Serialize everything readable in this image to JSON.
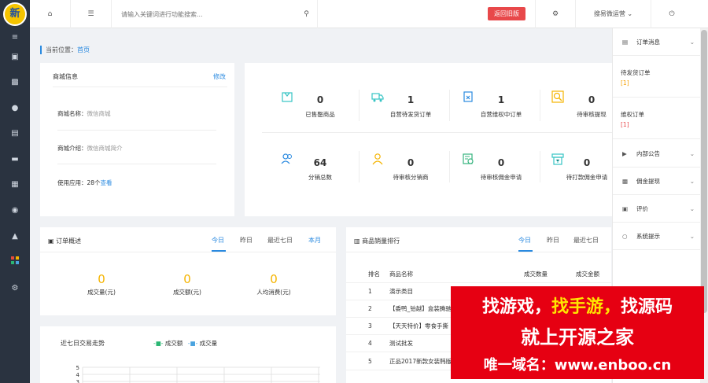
{
  "logo": {
    "text": "新"
  },
  "topbar": {
    "search_placeholder": "请输入关键词进行功能搜索...",
    "back_button": "返回旧版",
    "user_name": "搜易微运营"
  },
  "breadcrumb": {
    "label": "当前位置：",
    "current": "首页"
  },
  "shop_info": {
    "title": "商城信息",
    "edit_label": "修改",
    "name_label": "商城名称：",
    "name_value": "微信商城",
    "desc_label": "商城介绍：",
    "desc_value": "微信商城简介",
    "apps_label": "使用应用：",
    "apps_value": "28个",
    "apps_link": "查看"
  },
  "stats": [
    {
      "value": "0",
      "label": "已售罄商品",
      "icon": "box-icon"
    },
    {
      "value": "1",
      "label": "自营待发货订单",
      "icon": "truck-icon"
    },
    {
      "value": "1",
      "label": "自营维权中订单",
      "icon": "document-icon"
    },
    {
      "value": "0",
      "label": "待审核提现",
      "icon": "magnifier-icon"
    },
    {
      "value": "64",
      "label": "分销总数",
      "icon": "users-icon"
    },
    {
      "value": "0",
      "label": "待审核分销商",
      "icon": "user-icon"
    },
    {
      "value": "0",
      "label": "待审核佣金申请",
      "icon": "form-icon"
    },
    {
      "value": "0",
      "label": "待打款佣金申请",
      "icon": "cashier-icon"
    }
  ],
  "order_overview": {
    "title": "订单概述",
    "tabs": [
      "今日",
      "昨日",
      "最近七日",
      "本月"
    ],
    "metrics": [
      {
        "value": "0",
        "label": "成交量(元)"
      },
      {
        "value": "0",
        "label": "成交额(元)"
      },
      {
        "value": "0",
        "label": "人均消费(元)"
      }
    ]
  },
  "trend": {
    "title": "近七日交易走势",
    "legend": [
      "成交额",
      "成交量"
    ],
    "colors": [
      "#2bb673",
      "#4aa3df"
    ]
  },
  "chart_data": {
    "type": "line",
    "title": "近七日交易走势",
    "series": [
      {
        "name": "成交额",
        "values": []
      },
      {
        "name": "成交量",
        "values": []
      }
    ],
    "yticks": [
      5,
      4,
      3
    ],
    "legend": "top"
  },
  "ranking": {
    "title": "商品销量排行",
    "tabs": [
      "今日",
      "昨日",
      "最近七日"
    ],
    "headers": [
      "排名",
      "商品名称",
      "成交数量",
      "成交金额"
    ],
    "rows": [
      {
        "rank": "1",
        "name": "演示类目"
      },
      {
        "rank": "2",
        "name": "【委鸭_铂越】盒装腾驰"
      },
      {
        "rank": "3",
        "name": "【天天特价】零食手撕"
      },
      {
        "rank": "4",
        "name": "测试批发"
      },
      {
        "rank": "5",
        "name": "正品2017新款女装韩版"
      }
    ]
  },
  "right_panel": {
    "order_msg": "订单消息",
    "pending_ship": "待发货订单",
    "pending_ship_count": "[1]",
    "rights_order": "维权订单",
    "rights_count": "[1]",
    "internal_notice": "内部公告",
    "commission": "佣金提现",
    "review": "评价",
    "system": "系统提示"
  },
  "banner": {
    "line1a": "找游戏，",
    "line1b": "找手游，",
    "line1c": "找源码",
    "line2": "就上开源之家",
    "line3": "唯一域名：www.enboo.cn"
  },
  "colors": {
    "accent": "#2a8ae0",
    "sidebar": "#2a3340",
    "back_button": "#e8484a",
    "highlight": "#f5b400",
    "banner": "#e60012"
  }
}
